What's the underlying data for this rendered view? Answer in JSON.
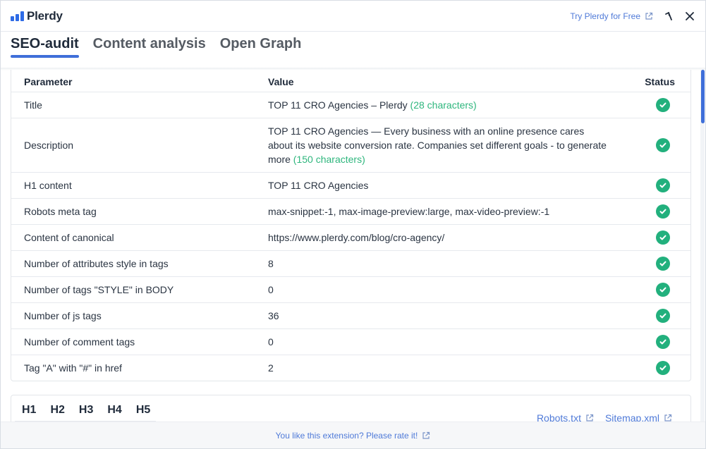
{
  "header": {
    "logo_text": "Plerdy",
    "try_label": "Try Plerdy for Free",
    "brand_color": "#2e6be6"
  },
  "tabs": [
    {
      "label": "SEO-audit",
      "active": true
    },
    {
      "label": "Content analysis",
      "active": false
    },
    {
      "label": "Open Graph",
      "active": false
    }
  ],
  "table": {
    "headers": {
      "parameter": "Parameter",
      "value": "Value",
      "status": "Status"
    },
    "rows": [
      {
        "parameter": "Title",
        "value": "TOP 11 CRO Agencies – Plerdy",
        "count": "(28 characters)",
        "status": "ok"
      },
      {
        "parameter": "Description",
        "value": "TOP 11 CRO Agencies — Every business with an online presence cares about its website conversion rate. Companies set different goals - to generate more",
        "count": "(150 characters)",
        "status": "ok"
      },
      {
        "parameter": "H1 content",
        "value": "TOP 11 CRO Agencies",
        "count": "",
        "status": "ok"
      },
      {
        "parameter": "Robots meta tag",
        "value": "max-snippet:-1, max-image-preview:large, max-video-preview:-1",
        "count": "",
        "status": "ok"
      },
      {
        "parameter": "Content of canonical",
        "value": "https://www.plerdy.com/blog/cro-agency/",
        "count": "",
        "status": "ok"
      },
      {
        "parameter": "Number of attributes style in tags",
        "value": "8",
        "count": "",
        "status": "ok"
      },
      {
        "parameter": "Number of tags \"STYLE\" in BODY",
        "value": "0",
        "count": "",
        "status": "ok"
      },
      {
        "parameter": "Number of js tags",
        "value": "36",
        "count": "",
        "status": "ok"
      },
      {
        "parameter": "Number of comment tags",
        "value": "0",
        "count": "",
        "status": "ok"
      },
      {
        "parameter": "Tag \"A\" with \"#\" in href",
        "value": "2",
        "count": "",
        "status": "ok"
      }
    ]
  },
  "headings": {
    "tags": [
      "H1",
      "H2",
      "H3",
      "H4",
      "H5"
    ],
    "robots_label": "Robots.txt",
    "sitemap_label": "Sitemap.xml"
  },
  "footer": {
    "rate_label": "You like this extension? Please rate it!"
  },
  "colors": {
    "accent": "#3f6fd9",
    "link": "#4f7ad8",
    "ok": "#22b07d",
    "count": "#2eb67d"
  }
}
